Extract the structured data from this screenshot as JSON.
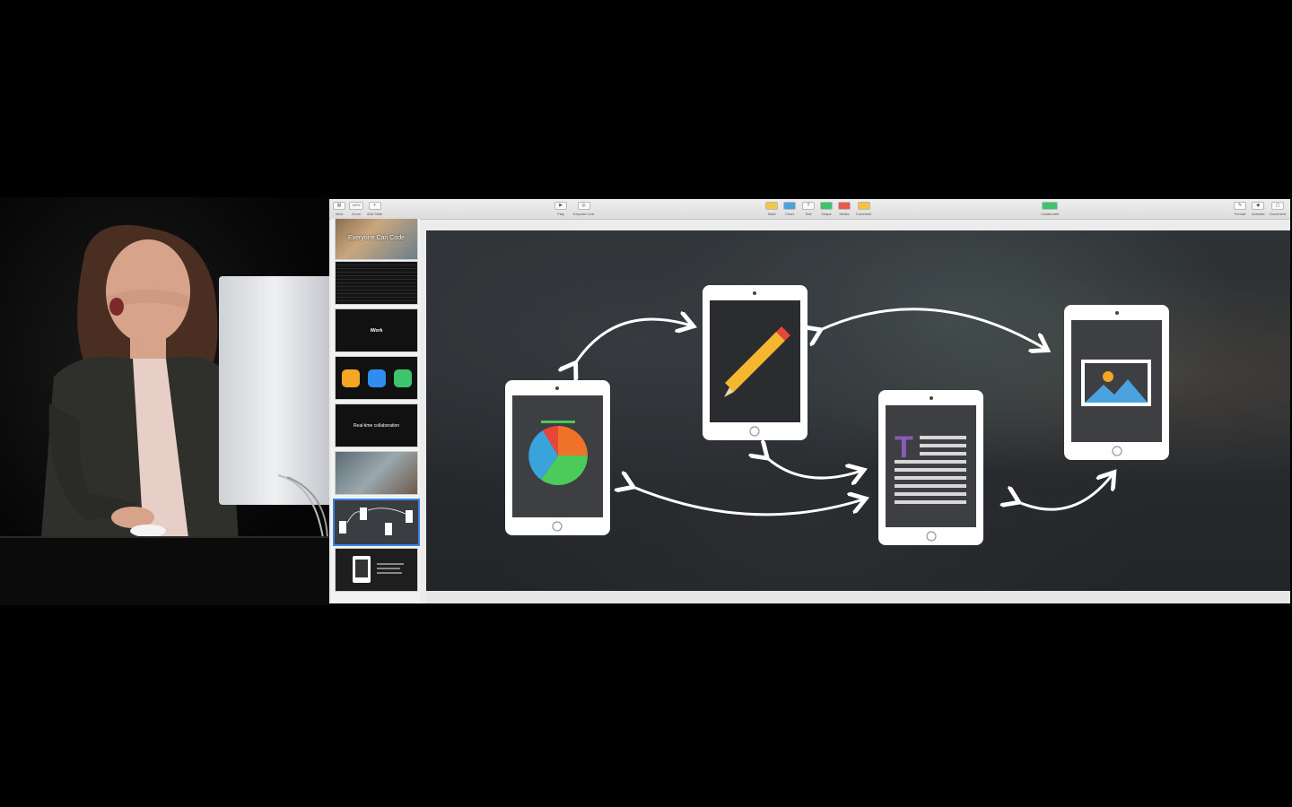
{
  "toolbar": {
    "left_items": [
      {
        "label": "View",
        "icon": "view-icon"
      },
      {
        "label": "Zoom",
        "value": "100%",
        "icon": "zoom-icon"
      },
      {
        "label": "Add Slide",
        "icon": "plus-icon"
      }
    ],
    "center_left_items": [
      {
        "label": "Play",
        "icon": "play-icon"
      },
      {
        "label": "Keynote Live",
        "icon": "keynote-live-icon"
      }
    ],
    "insert_items": [
      {
        "label": "Table",
        "icon": "table-icon",
        "color": "#f2c744"
      },
      {
        "label": "Chart",
        "icon": "chart-icon",
        "color": "#4aa3df"
      },
      {
        "label": "Text",
        "icon": "text-icon",
        "color": "#888888"
      },
      {
        "label": "Shape",
        "icon": "shape-icon",
        "color": "#3ec46d"
      },
      {
        "label": "Media",
        "icon": "media-icon",
        "color": "#e8584b"
      },
      {
        "label": "Comment",
        "icon": "comment-icon",
        "color": "#f5c23a"
      }
    ],
    "collaborate": {
      "label": "Collaborate",
      "icon": "collaborate-icon",
      "color": "#3ec46d"
    },
    "right_items": [
      {
        "label": "Format",
        "icon": "format-icon"
      },
      {
        "label": "Animate",
        "icon": "animate-icon"
      },
      {
        "label": "Document",
        "icon": "document-icon"
      }
    ]
  },
  "slides": [
    {
      "title": "Everyone Can Code",
      "style": "photo"
    },
    {
      "title": "",
      "style": "code"
    },
    {
      "title": "iWork",
      "style": "dark"
    },
    {
      "title": "",
      "style": "app-icons"
    },
    {
      "title": "Real-time collaboration",
      "style": "dark"
    },
    {
      "title": "",
      "style": "photo"
    },
    {
      "title": "",
      "style": "diagram",
      "selected": true
    },
    {
      "title": "",
      "style": "ipad-dark"
    }
  ],
  "colors": {
    "accent": "#3b82e6",
    "pie_orange": "#f0712a",
    "pie_blue": "#3aa3dc",
    "pie_green": "#4ccb5a",
    "pie_red": "#e8463a",
    "pencil_yellow": "#f5b630",
    "text_purple": "#8b5bb8",
    "image_orange": "#f5a623",
    "image_blue": "#4aa3df"
  }
}
